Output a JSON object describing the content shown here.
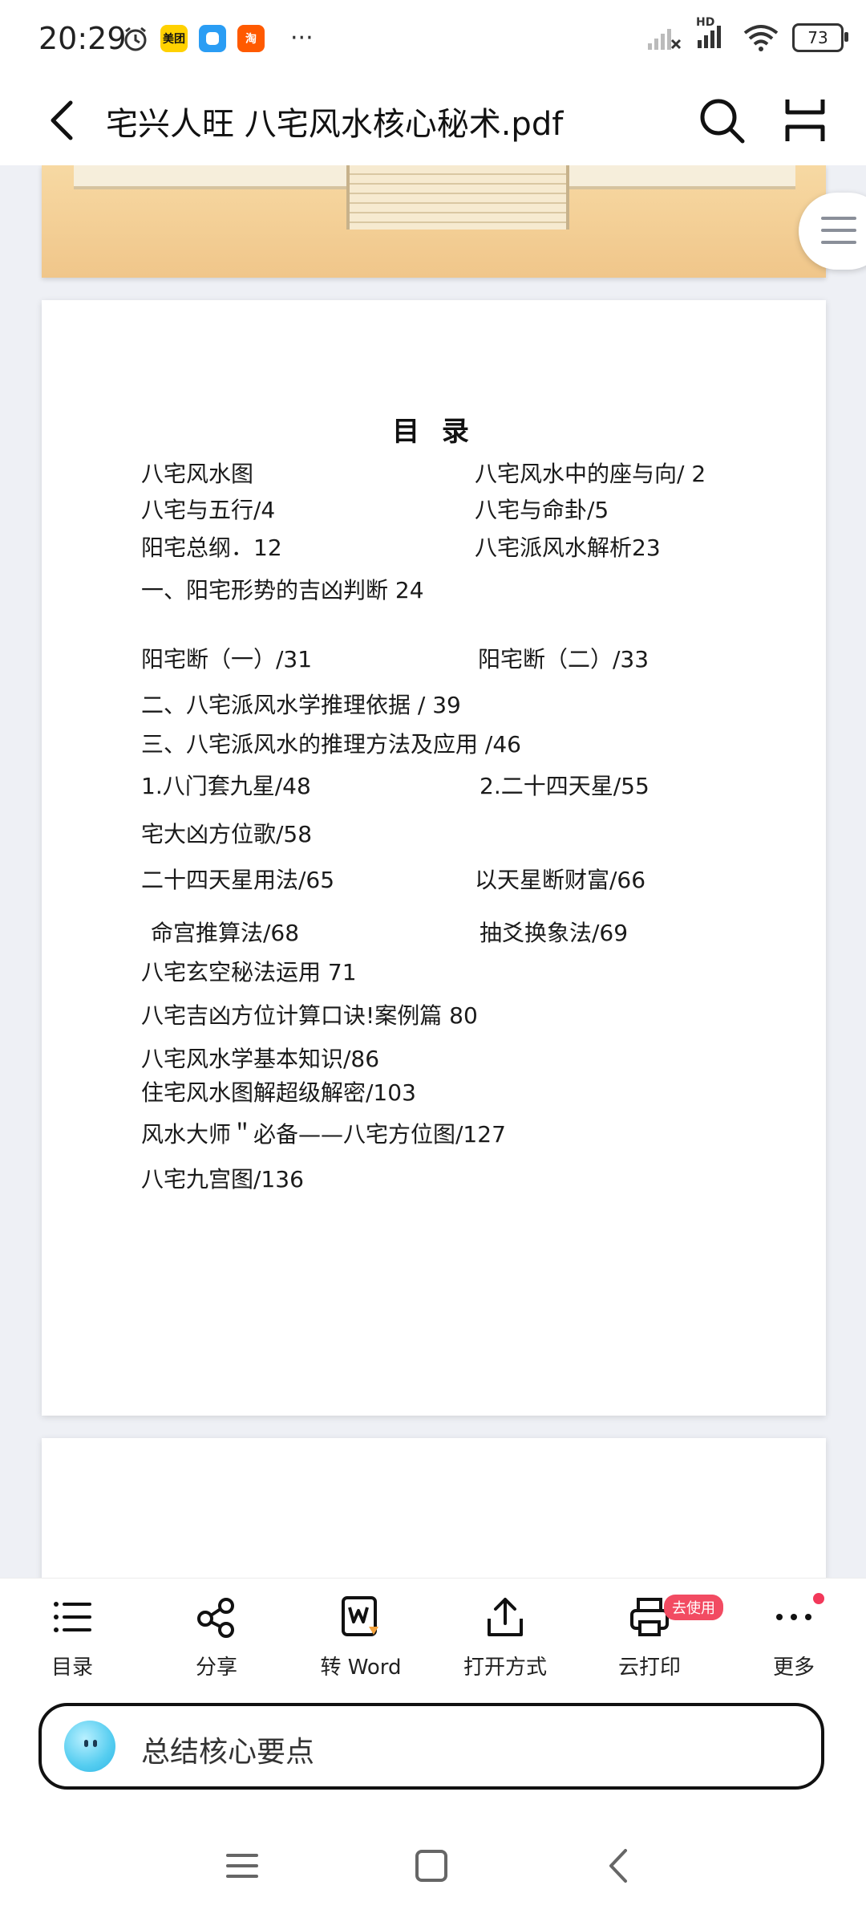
{
  "status_bar": {
    "time": "20:29",
    "apps": [
      {
        "label": "美团",
        "color": "#ffd100"
      },
      {
        "label": "",
        "color": "#2a9df4"
      },
      {
        "label": "淘",
        "color": "#ff5a00"
      }
    ],
    "more": "···",
    "network": "HD",
    "battery": "73"
  },
  "app_bar": {
    "title": "宅兴人旺 八宅风水核心秘术.pdf"
  },
  "toc": {
    "heading": "目 录",
    "entries": [
      "八宅风水图",
      "八宅风水中的座与向/ 2",
      "八宅与五行/4",
      "八宅与命卦/5",
      "阳宅总纲．12",
      "八宅派风水解析23",
      "一、阳宅形势的吉凶判断 24",
      "阳宅断（一）/31",
      "阳宅断（二）/33",
      "二、八宅派风水学推理依据 / 39",
      "三、八宅派风水的推理方法及应用 /46",
      "1.八门套九星/48",
      "2.二十四天星/55",
      "宅大凶方位歌/58",
      "二十四天星用法/65",
      "以天星断财富/66",
      "命宫推算法/68",
      "抽爻换象法/69",
      "八宅玄空秘法运用 71",
      "八宅吉凶方位计算口诀!案例篇 80",
      "八宅风水学基本知识/86",
      "住宅风水图解超级解密/103",
      "风水大师＂必备——八宅方位图/127",
      "八宅九宫图/136"
    ]
  },
  "toolbar": {
    "items": [
      {
        "label": "目录"
      },
      {
        "label": "分享"
      },
      {
        "label": "转 Word"
      },
      {
        "label": "打开方式"
      },
      {
        "label": "云打印",
        "badge": "去使用"
      },
      {
        "label": "更多"
      }
    ]
  },
  "summary": {
    "text": "总结核心要点"
  },
  "colors": {
    "accent_red": "#f24b62",
    "page_bg": "#eef0f5"
  }
}
